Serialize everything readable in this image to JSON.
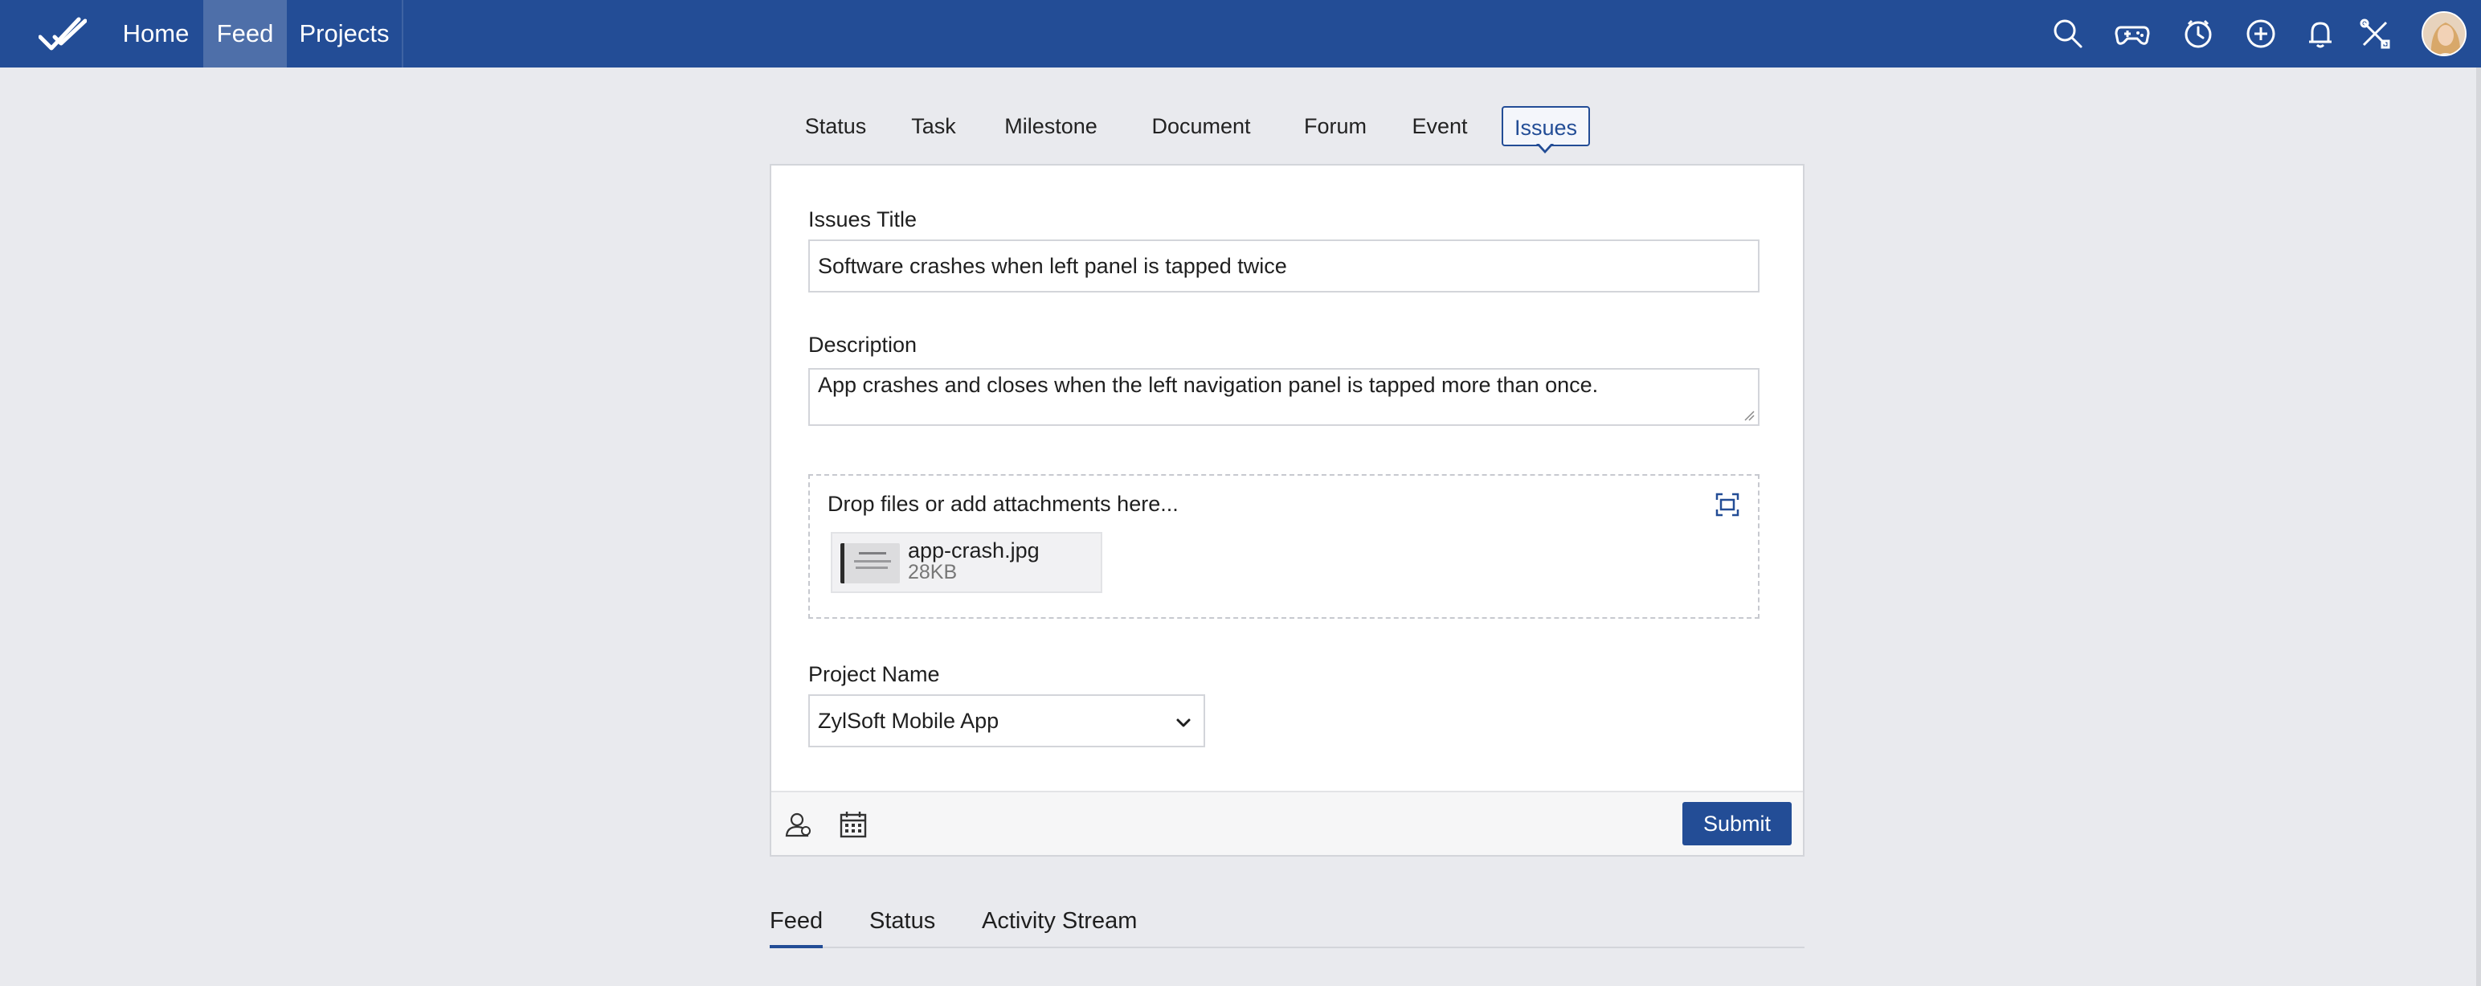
{
  "topbar": {
    "nav": [
      {
        "label": "Home"
      },
      {
        "label": "Feed"
      },
      {
        "label": "Projects"
      }
    ],
    "icons": [
      "search-icon",
      "gamepad-icon",
      "timer-icon",
      "add-icon",
      "bell-icon",
      "tools-icon"
    ]
  },
  "type_tabs": [
    "Status",
    "Task",
    "Milestone",
    "Document",
    "Forum",
    "Event",
    "Issues"
  ],
  "active_type_tab": "Issues",
  "form": {
    "title_label": "Issues Title",
    "title_value": "Software crashes when left panel is tapped twice",
    "description_label": "Description",
    "description_value": "App crashes and closes when the left navigation panel is tapped more than once.",
    "dropzone_text": "Drop files or add attachments here...",
    "attachment": {
      "name": "app-crash.jpg",
      "size": "28KB"
    },
    "project_label": "Project Name",
    "project_value": "ZylSoft Mobile App",
    "submit_label": "Submit"
  },
  "bottom_tabs": [
    "Feed",
    "Status",
    "Activity Stream"
  ],
  "active_bottom_tab": "Feed",
  "colors": {
    "brand": "#234d96",
    "background": "#e9eaee"
  }
}
